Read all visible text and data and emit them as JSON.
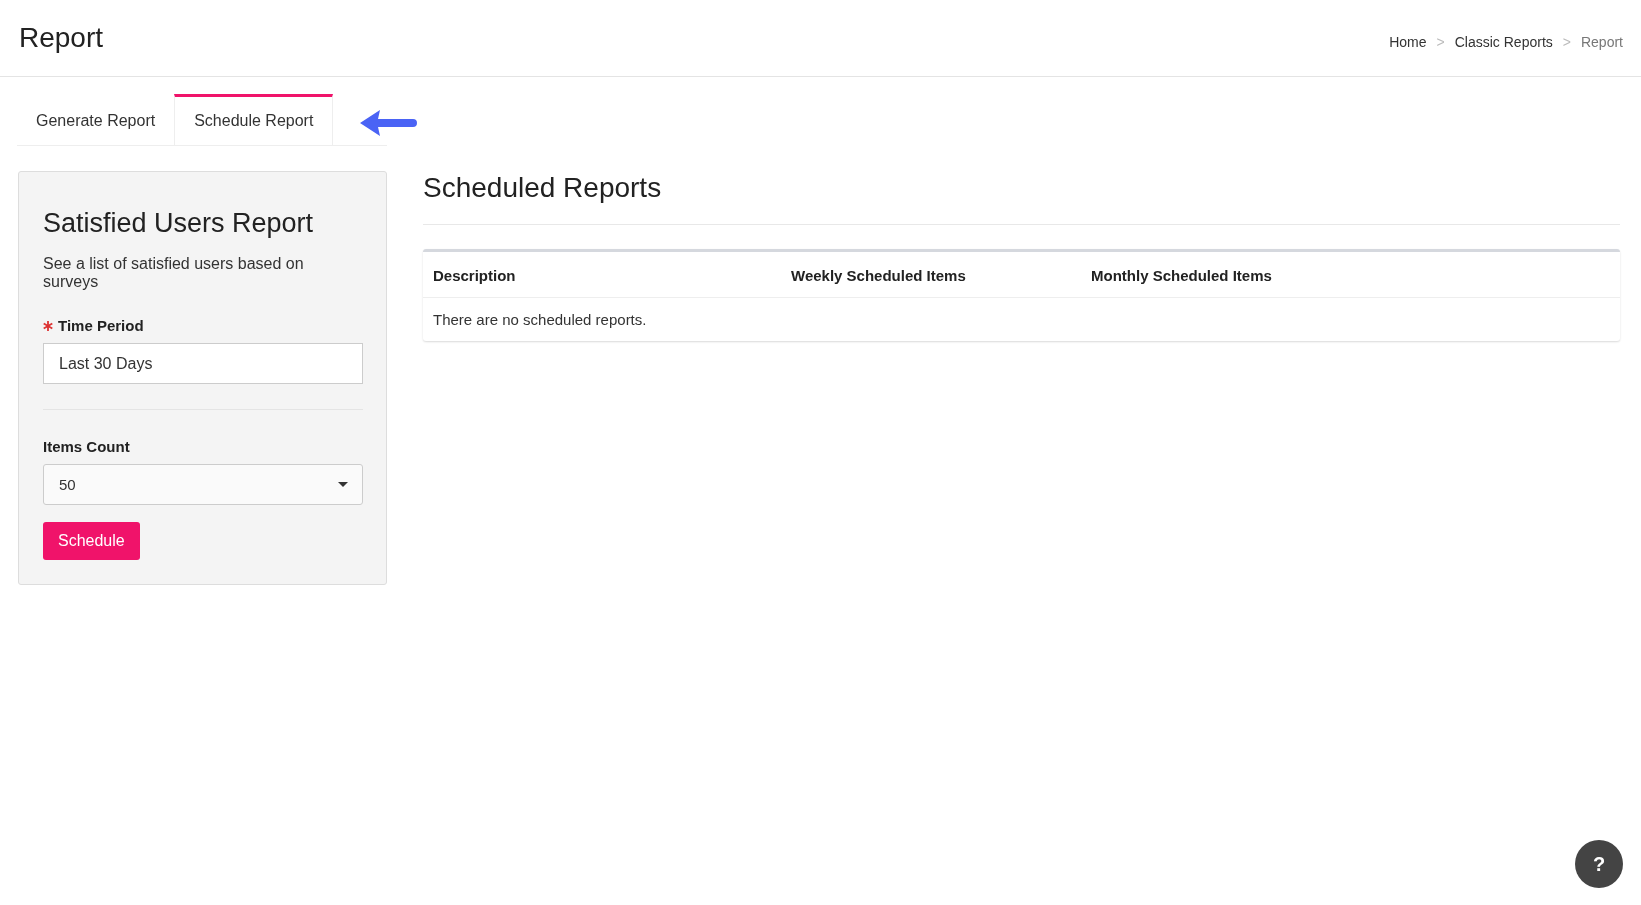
{
  "header": {
    "title": "Report",
    "breadcrumb": [
      {
        "label": "Home",
        "current": false
      },
      {
        "label": "Classic Reports",
        "current": false
      },
      {
        "label": "Report",
        "current": true
      }
    ],
    "separator": ">"
  },
  "tabs": [
    {
      "label": "Generate Report",
      "selected": false
    },
    {
      "label": "Schedule Report",
      "selected": true
    }
  ],
  "form": {
    "title": "Satisfied Users Report",
    "description": "See a list of satisfied users based on surveys",
    "fields": [
      {
        "kind": "text",
        "label": "Time Period",
        "required": true,
        "value": "Last 30 Days"
      },
      {
        "kind": "select",
        "label": "Items Count",
        "required": false,
        "value": "50"
      }
    ],
    "button": "Schedule"
  },
  "scheduled": {
    "title": "Scheduled Reports",
    "columns": [
      "Description",
      "Weekly Scheduled Items",
      "Monthly Scheduled Items"
    ],
    "empty_message": "There are no scheduled reports."
  },
  "help_button": "?"
}
